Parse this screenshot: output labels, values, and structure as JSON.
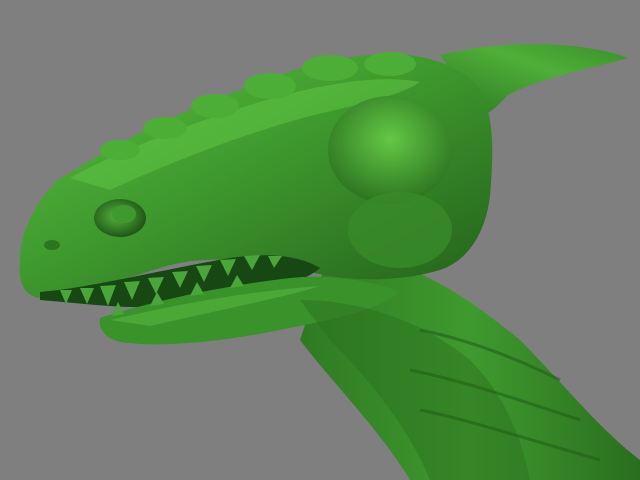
{
  "viewport": {
    "background_color": "#7f7f7f"
  },
  "model": {
    "subject": "dragon-head",
    "colors": {
      "base": "#3f9a2e",
      "highlight": "#6fd04c",
      "shadow": "#1f5c17",
      "deep_shadow": "#174712",
      "teeth": "#4aa63a"
    }
  }
}
